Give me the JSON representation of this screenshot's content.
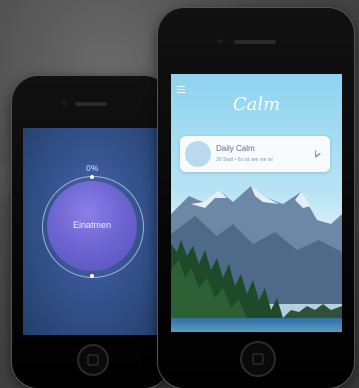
{
  "left_phone": {
    "progress_percent_label": "0%",
    "breath_instruction": "Einatmen"
  },
  "right_phone": {
    "app_name": "Calm",
    "daily_card": {
      "title": "Daily Calm",
      "subtitle": "30 Sept • 6x ist wie nie ist"
    },
    "icons": {
      "menu": "menu-icon",
      "play": "play-icon"
    }
  },
  "colors": {
    "background": "#4a4a4a",
    "breath_circle": "#6b63cf",
    "calm_sky": "#8fd3ef",
    "card_bg": "#f7fbfd"
  }
}
